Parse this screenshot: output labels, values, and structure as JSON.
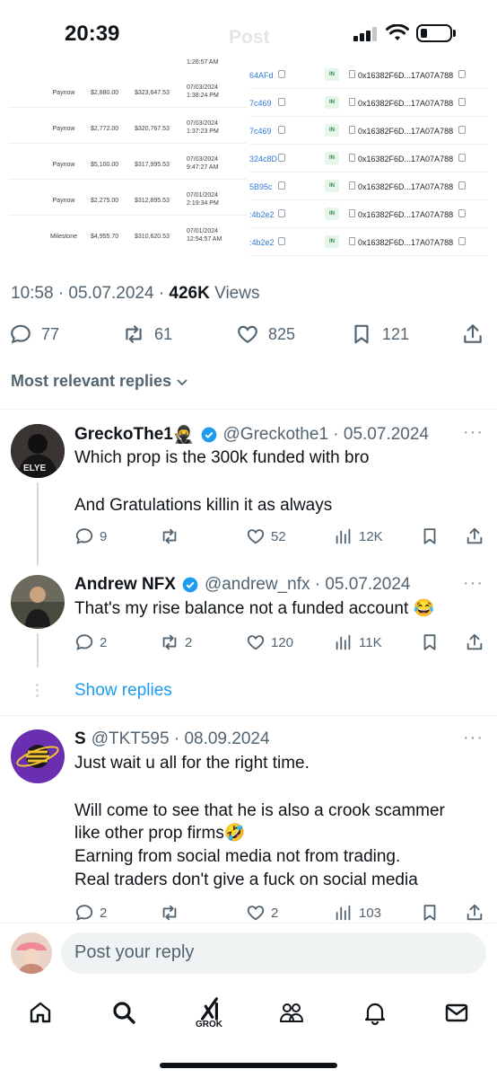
{
  "status_bar": {
    "time": "20:39",
    "ghost_title": "Post"
  },
  "media": {
    "top_partial_time": "1:26:57 AM",
    "left_rows": [
      {
        "name": "Paynow",
        "amount": "$2,880.00",
        "balance": "$323,647.53",
        "date": "07/03/2024",
        "time": "1:38:24 PM"
      },
      {
        "name": "Paynow",
        "amount": "$2,772.00",
        "balance": "$320,767.53",
        "date": "07/03/2024",
        "time": "1:37:23 PM"
      },
      {
        "name": "Paynow",
        "amount": "$5,100.00",
        "balance": "$317,995.53",
        "date": "07/03/2024",
        "time": "9:47:27 AM"
      },
      {
        "name": "Paynow",
        "amount": "$2,275.00",
        "balance": "$312,895.53",
        "date": "07/01/2024",
        "time": "2:19:34 PM"
      },
      {
        "name": "Milestone",
        "amount": "$4,955.70",
        "balance": "$310,620.53",
        "date": "07/01/2024",
        "time": "12:54:57 AM"
      }
    ],
    "right_rows": [
      {
        "addr": "64AFd",
        "badge": "IN",
        "hash": "0x16382F6D...17A07A788"
      },
      {
        "addr": "7c469",
        "badge": "IN",
        "hash": "0x16382F6D...17A07A788"
      },
      {
        "addr": "7c469",
        "badge": "IN",
        "hash": "0x16382F6D...17A07A788"
      },
      {
        "addr": "324c8D",
        "badge": "IN",
        "hash": "0x16382F6D...17A07A788"
      },
      {
        "addr": "5B95c",
        "badge": "IN",
        "hash": "0x16382F6D...17A07A788"
      },
      {
        "addr": ":4b2e2",
        "badge": "IN",
        "hash": "0x16382F6D...17A07A788"
      },
      {
        "addr": ":4b2e2",
        "badge": "IN",
        "hash": "0x16382F6D...17A07A788"
      }
    ]
  },
  "tweet": {
    "time_date": "10:58 · 05.07.2024 · ",
    "views_count": "426K",
    "views_label": " Views",
    "actions": {
      "replies": "77",
      "reposts": "61",
      "likes": "825",
      "bookmarks": "121"
    }
  },
  "replies_filter": {
    "label": "Most relevant replies"
  },
  "replies": [
    {
      "name": "GreckoThe1",
      "name_emoji": "🥷",
      "handle": "@Greckothe1 · 05.07.2024",
      "line1": "Which prop is the 300k funded with bro",
      "line2": "And Gratulations killin it as always",
      "stats": {
        "replies": "9",
        "reposts": "",
        "likes": "52",
        "views": "12K"
      }
    },
    {
      "name": "Andrew NFX",
      "handle": "@andrew_nfx · 05.07.2024",
      "line1": "That's my rise balance not a funded account 😂",
      "stats": {
        "replies": "2",
        "reposts": "2",
        "likes": "120",
        "views": "11K"
      }
    },
    {
      "name": "S",
      "handle": "@TKT595 · 08.09.2024",
      "line1": "Just wait u all for the right time.",
      "line2": "Will come to see that he is also a crook scammer",
      "line3": "like other prop firms🤣",
      "line4": "Earning from social media not from trading.",
      "line5": "Real traders don't give a fuck on social media",
      "stats": {
        "replies": "2",
        "reposts": "",
        "likes": "2",
        "views": "103"
      }
    }
  ],
  "show_replies": "Show replies",
  "more_glyph": "···",
  "composer": {
    "placeholder": "Post your reply"
  },
  "tabbar": {
    "grok_label": "GROK"
  },
  "colors": {
    "accent": "#1d9bf0",
    "muted": "#536471",
    "text": "#0f1419"
  }
}
